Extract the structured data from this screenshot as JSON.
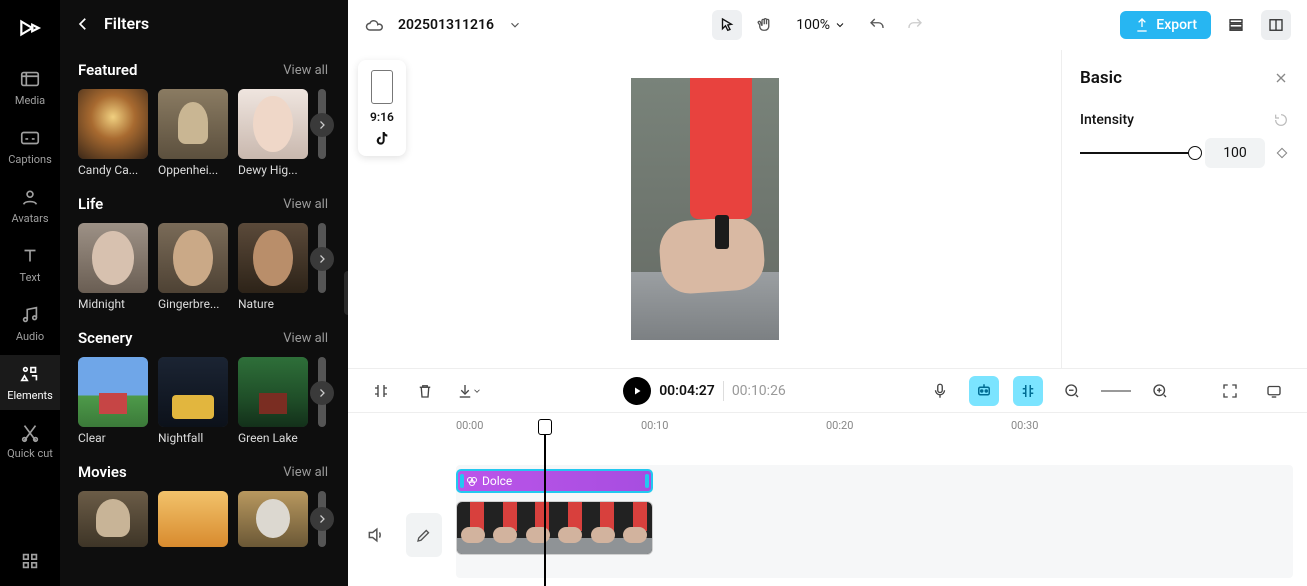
{
  "rail": {
    "items": [
      {
        "label": "Media"
      },
      {
        "label": "Captions"
      },
      {
        "label": "Avatars"
      },
      {
        "label": "Text"
      },
      {
        "label": "Audio"
      },
      {
        "label": "Elements"
      },
      {
        "label": "Quick cut"
      }
    ]
  },
  "panel": {
    "title": "Filters",
    "view_all": "View all",
    "categories": [
      {
        "title": "Featured",
        "items": [
          {
            "label": "Candy Ca..."
          },
          {
            "label": "Oppenhei..."
          },
          {
            "label": "Dewy Hig..."
          }
        ]
      },
      {
        "title": "Life",
        "items": [
          {
            "label": "Midnight"
          },
          {
            "label": "Gingerbre..."
          },
          {
            "label": "Nature"
          }
        ]
      },
      {
        "title": "Scenery",
        "items": [
          {
            "label": "Clear"
          },
          {
            "label": "Nightfall"
          },
          {
            "label": "Green Lake"
          }
        ]
      },
      {
        "title": "Movies",
        "items": [
          {
            "label": ""
          },
          {
            "label": ""
          },
          {
            "label": ""
          }
        ]
      }
    ]
  },
  "topbar": {
    "project_name": "202501311216",
    "zoom": "100%",
    "export": "Export"
  },
  "ratio_card": {
    "label": "9:16"
  },
  "inspector": {
    "title": "Basic",
    "intensity_label": "Intensity",
    "intensity_value": "100"
  },
  "timeline": {
    "current": "00:04:27",
    "total": "00:10:26",
    "marks": [
      "00:00",
      "00:10",
      "00:20",
      "00:30"
    ],
    "filter_clip_label": "Dolce"
  }
}
